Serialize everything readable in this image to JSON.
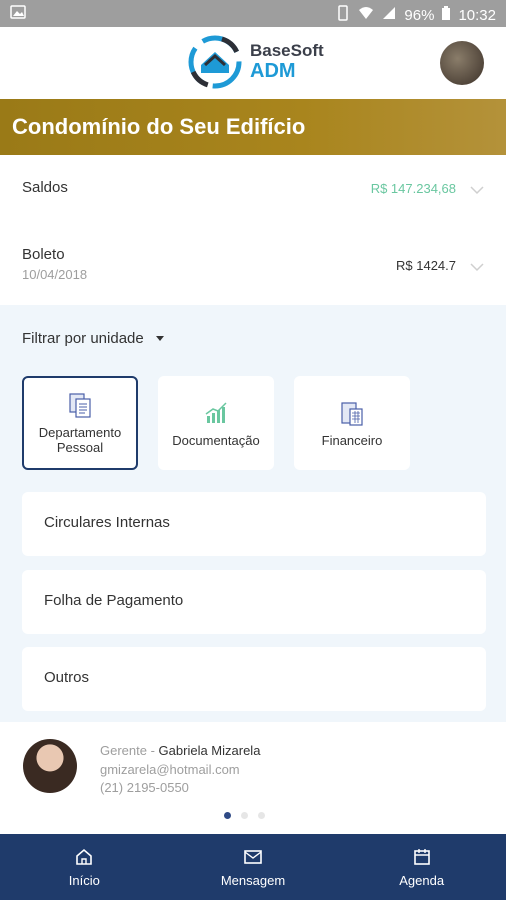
{
  "status_bar": {
    "battery": "96%",
    "time": "10:32"
  },
  "header": {
    "logo_line1": "BaseSoft",
    "logo_line2": "ADM"
  },
  "banner": {
    "title": "Condomínio do Seu Edifício"
  },
  "summary": {
    "saldos_label": "Saldos",
    "saldos_value": "R$ 147.234,68",
    "boleto_label": "Boleto",
    "boleto_date": "10/04/2018",
    "boleto_value": "R$ 1424.7"
  },
  "filter": {
    "label": "Filtrar por unidade"
  },
  "categories": [
    {
      "label_line1": "Departamento",
      "label_line2": "Pessoal",
      "icon": "document-icon"
    },
    {
      "label_line1": "Documentação",
      "label_line2": "",
      "icon": "chart-icon"
    },
    {
      "label_line1": "Financeiro",
      "label_line2": "",
      "icon": "calculator-icon"
    }
  ],
  "list_items": [
    "Circulares Internas",
    "Folha de Pagamento",
    "Outros"
  ],
  "manager": {
    "role": "Gerente",
    "name": "Gabriela Mizarela",
    "email": "gmizarela@hotmail.com",
    "phone": "(21) 2195-0550"
  },
  "bottom_nav": [
    {
      "label": "Início",
      "icon": "home-icon"
    },
    {
      "label": "Mensagem",
      "icon": "mail-icon"
    },
    {
      "label": "Agenda",
      "icon": "calendar-icon"
    }
  ],
  "colors": {
    "banner": "#a9851d",
    "nav": "#1f3b6b",
    "saldo_green": "#6ac7a0",
    "accent_blue": "#1e9ad6"
  }
}
